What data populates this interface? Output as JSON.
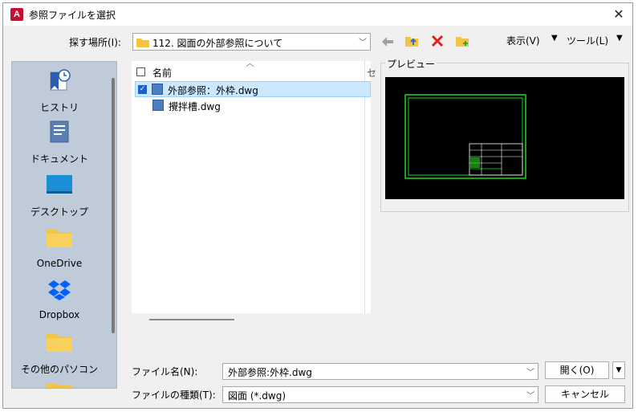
{
  "window": {
    "title": "参照ファイルを選択",
    "app_icon_letter": "A"
  },
  "toolbar": {
    "look_in_label": "探す場所(I):",
    "look_in_value": "112. 図面の外部参照について",
    "view_menu": "表示(V)",
    "tools_menu": "ツール(L)",
    "icons": [
      "back-arrow-icon",
      "up-folder-icon",
      "delete-icon",
      "new-folder-icon"
    ]
  },
  "places": [
    {
      "label": "ヒストリ",
      "icon": "history-icon"
    },
    {
      "label": "ドキュメント",
      "icon": "documents-icon"
    },
    {
      "label": "デスクトップ",
      "icon": "desktop-icon"
    },
    {
      "label": "OneDrive",
      "icon": "folder-icon"
    },
    {
      "label": "Dropbox",
      "icon": "dropbox-icon"
    },
    {
      "label": "その他のパソコン",
      "icon": "folder-icon"
    }
  ],
  "file_list": {
    "header_name": "名前",
    "header_col2": "セ",
    "files": [
      {
        "name": "外部参照：外枠.dwg",
        "selected": true
      },
      {
        "name": "攪拌槽.dwg",
        "selected": false
      }
    ]
  },
  "preview": {
    "label": "プレビュー"
  },
  "bottom": {
    "filename_label": "ファイル名(N):",
    "filename_value": "外部参照:外枠.dwg",
    "filetype_label": "ファイルの種類(T):",
    "filetype_value": "図面 (*.dwg)",
    "open_button": "開く(O)",
    "cancel_button": "キャンセル"
  },
  "colors": {
    "places_bg": "#bfcbd8",
    "selection": "#cce8ff",
    "preview_bg": "#000000",
    "preview_lines": "#1fd81f",
    "accent": "#1e5ec8",
    "delete": "#e02020",
    "folder": "#f4c542"
  }
}
